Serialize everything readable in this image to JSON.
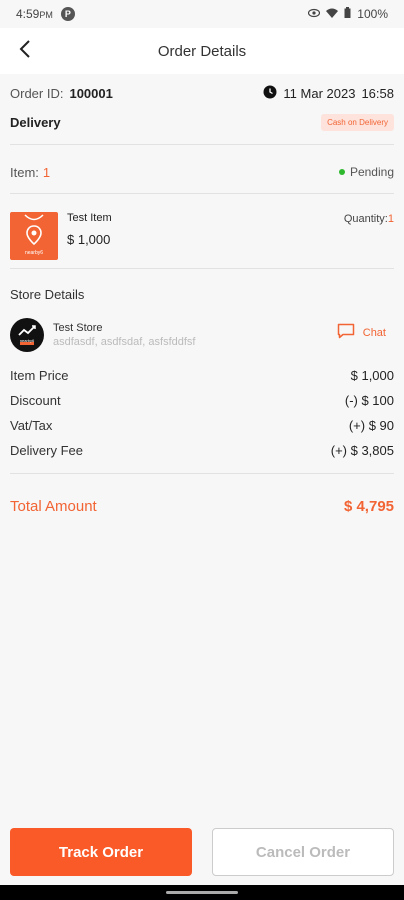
{
  "status_bar": {
    "time": "4:59",
    "time_suffix": "PM",
    "notification_badge": "P",
    "battery": "100%",
    "icons": [
      "eye-icon",
      "wifi-icon",
      "battery-icon"
    ]
  },
  "header": {
    "title": "Order Details",
    "back_icon": "chevron-left-icon"
  },
  "order": {
    "id_label": "Order ID:",
    "id_value": "100001",
    "date": "11 Mar 2023",
    "time": "16:58",
    "type": "Delivery",
    "payment_method": "Cash on Delivery"
  },
  "items_summary": {
    "label": "Item:",
    "count": "1",
    "status": "Pending"
  },
  "item": {
    "name": "Test Item",
    "price": "$ 1,000",
    "quantity_label": "Quantity:",
    "quantity_value": "1",
    "thumb_caption": "nearby6"
  },
  "store": {
    "section_title": "Store Details",
    "name": "Test Store",
    "address": "asdfasdf, asdfsdaf, asfsfddfsf",
    "logo_caption": "nearby6",
    "chat_label": "Chat"
  },
  "pricing": [
    {
      "label": "Item Price",
      "value": "$ 1,000"
    },
    {
      "label": "Discount",
      "value": "(-) $ 100"
    },
    {
      "label": "Vat/Tax",
      "value": "(+) $ 90"
    },
    {
      "label": "Delivery Fee",
      "value": "(+) $ 3,805"
    }
  ],
  "total": {
    "label": "Total Amount",
    "value": "$ 4,795"
  },
  "actions": {
    "track": "Track Order",
    "cancel": "Cancel Order"
  },
  "colors": {
    "accent": "#fa5a28",
    "status_pending": "#2eb82e",
    "badge_bg": "#fde3dc"
  }
}
